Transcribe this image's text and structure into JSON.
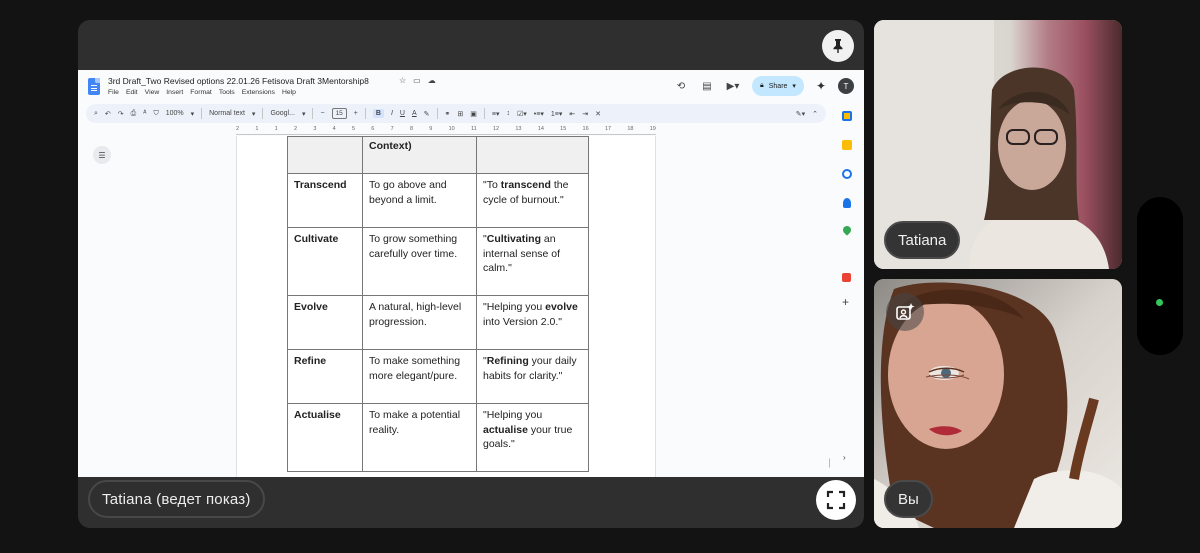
{
  "share": {
    "presenter_label": "Tatiana (ведет показ)"
  },
  "doc": {
    "title": "3rd Draft_Two Revised options 22.01.26  Fetisova Draft 3Mentorship8",
    "menu": [
      "File",
      "Edit",
      "View",
      "Insert",
      "Format",
      "Tools",
      "Extensions",
      "Help"
    ],
    "share_label": "Share",
    "avatar_initial": "T",
    "toolbar": {
      "zoom": "100%",
      "style": "Normal text",
      "font": "Googl...",
      "size": "15",
      "bold": "B",
      "italic": "I",
      "underline": "U",
      "text_color": "A"
    },
    "ruler_marks": [
      "2",
      "1",
      "1",
      "2",
      "3",
      "4",
      "5",
      "6",
      "7",
      "8",
      "9",
      "10",
      "11",
      "12",
      "13",
      "14",
      "15",
      "16",
      "17",
      "18",
      "19"
    ],
    "table": {
      "header_cells": [
        "",
        "Context)",
        ""
      ],
      "rows": [
        {
          "term": "Transcend",
          "definition": "To go above and beyond a limit.",
          "example_pre": "\"To ",
          "example_bold": "transcend",
          "example_post": " the cycle of burnout.\""
        },
        {
          "term": "Cultivate",
          "definition": "To grow something carefully over time.",
          "example_pre": "\"",
          "example_bold": "Cultivating",
          "example_post": " an internal sense of calm.\""
        },
        {
          "term": "Evolve",
          "definition": "A natural, high-level progression.",
          "example_pre": "\"Helping you ",
          "example_bold": "evolve",
          "example_post": " into Version 2.0.\""
        },
        {
          "term": "Refine",
          "definition": "To make something more elegant/pure.",
          "example_pre": "\"",
          "example_bold": "Refining",
          "example_post": " your daily habits for clarity.\""
        },
        {
          "term": "Actualise",
          "definition": "To make a potential reality.",
          "example_pre": "\"Helping you ",
          "example_bold": "actualise",
          "example_post": " your true goals.\""
        }
      ]
    }
  },
  "participants": [
    {
      "name": "Tatiana"
    },
    {
      "name": "Вы"
    }
  ],
  "icons": {
    "pin": "pin-icon",
    "fullscreen": "fullscreen-icon",
    "effects": "visual-effects-icon"
  },
  "colors": {
    "background": "#131313",
    "tile": "#2f2f2f",
    "share_button": "#c2e7ff",
    "status_dot": "#34c759"
  }
}
